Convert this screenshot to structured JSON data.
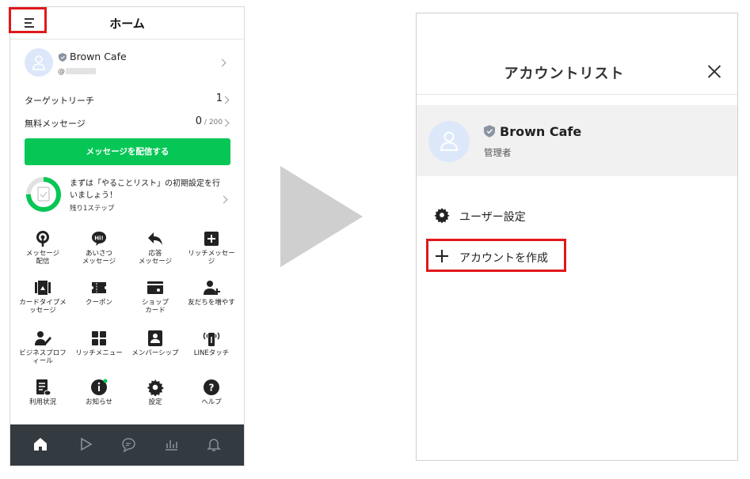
{
  "left_screen": {
    "header": {
      "title": "ホーム",
      "menu_icon": "menu-icon"
    },
    "profile": {
      "name": "Brown Cafe",
      "id_prefix": "@"
    },
    "stats": [
      {
        "label": "ターゲットリーチ",
        "value": "1",
        "suffix": ""
      },
      {
        "label": "無料メッセージ",
        "value": "0",
        "suffix": " / 200"
      }
    ],
    "send_button": "メッセージを配信する",
    "todo": {
      "text": "まずは「やることリスト」の初期設定を行いましょう！",
      "remaining": "残り1ステップ",
      "progress": 0.75
    },
    "menu": [
      {
        "label": "メッセージ\n配信",
        "icon": "broadcast-icon"
      },
      {
        "label": "あいさつ\nメッセージ",
        "icon": "greeting-icon"
      },
      {
        "label": "応答\nメッセージ",
        "icon": "reply-icon"
      },
      {
        "label": "リッチメッセー\nジ",
        "icon": "rich-message-icon"
      },
      {
        "label": "カードタイプメ\nッセージ",
        "icon": "card-type-icon"
      },
      {
        "label": "クーポン",
        "icon": "coupon-icon"
      },
      {
        "label": "ショップ\nカード",
        "icon": "shop-card-icon"
      },
      {
        "label": "友だちを増やす",
        "icon": "add-friend-icon"
      },
      {
        "label": "ビジネスプロフ\nィール",
        "icon": "business-profile-icon"
      },
      {
        "label": "リッチメニュー",
        "icon": "rich-menu-icon"
      },
      {
        "label": "メンバーシップ",
        "icon": "membership-icon"
      },
      {
        "label": "LINEタッチ",
        "icon": "line-touch-icon"
      },
      {
        "label": "利用状況",
        "icon": "usage-icon"
      },
      {
        "label": "お知らせ",
        "icon": "info-icon"
      },
      {
        "label": "設定",
        "icon": "settings-gear-icon"
      },
      {
        "label": "ヘルプ",
        "icon": "help-icon"
      }
    ],
    "bottom_nav": [
      "home-icon",
      "play-icon",
      "chat-icon",
      "chart-icon",
      "bell-icon"
    ]
  },
  "right_screen": {
    "title": "アカウントリスト",
    "account": {
      "name": "Brown Cafe",
      "role": "管理者"
    },
    "user_settings": "ユーザー設定",
    "create_account": "アカウントを作成"
  },
  "colors": {
    "line_green": "#06c755",
    "highlight_red": "#e0181b",
    "nav_dark": "#333a40"
  }
}
